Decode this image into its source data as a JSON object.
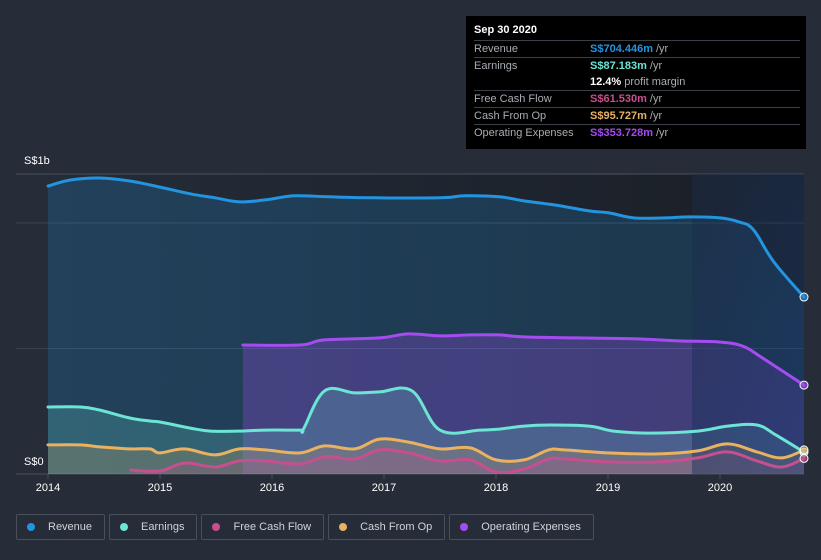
{
  "tooltip": {
    "date": "Sep 30 2020",
    "rows": [
      {
        "label": "Revenue",
        "value": "S$704.446m",
        "unit": "/yr",
        "color": "#2394df"
      },
      {
        "label": "Earnings",
        "value": "S$87.183m",
        "unit": "/yr",
        "color": "#6ce5d5"
      },
      {
        "label": "",
        "value": "12.4%",
        "unit": "profit margin",
        "color": "#ffffff"
      },
      {
        "label": "Free Cash Flow",
        "value": "S$61.530m",
        "unit": "/yr",
        "color": "#c84f8f"
      },
      {
        "label": "Cash From Op",
        "value": "S$95.727m",
        "unit": "/yr",
        "color": "#e9b160"
      },
      {
        "label": "Operating Expenses",
        "value": "S$353.728m",
        "unit": "/yr",
        "color": "#a54cf0"
      }
    ]
  },
  "legend": [
    {
      "label": "Revenue",
      "color": "#2394df"
    },
    {
      "label": "Earnings",
      "color": "#6ce5d5"
    },
    {
      "label": "Free Cash Flow",
      "color": "#c84f8f"
    },
    {
      "label": "Cash From Op",
      "color": "#e9b160"
    },
    {
      "label": "Operating Expenses",
      "color": "#a54cf0"
    }
  ],
  "chart_data": {
    "type": "area",
    "title": "",
    "xlabel": "",
    "ylabel": "",
    "y_tick_labels": [
      "S$0",
      "S$1b"
    ],
    "y_ticks": [
      0,
      1000
    ],
    "ylim": [
      0,
      1195
    ],
    "x_tick_labels": [
      "2014",
      "2015",
      "2016",
      "2017",
      "2018",
      "2019",
      "2020"
    ],
    "xlim": [
      2014.0,
      2020.75
    ],
    "grid": true,
    "legend_position": "bottom",
    "units": "S$ millions",
    "highlight_range": [
      2019.75,
      2020.75
    ],
    "series": [
      {
        "name": "Revenue",
        "color": "#2394df",
        "x": [
          2014.0,
          2014.2,
          2014.46,
          2014.73,
          2015.0,
          2015.27,
          2015.49,
          2015.71,
          2015.94,
          2016.2,
          2016.51,
          2016.91,
          2017.5,
          2017.72,
          2018.03,
          2018.25,
          2018.52,
          2018.83,
          2019.01,
          2019.23,
          2019.5,
          2019.73,
          2020.0,
          2020.17,
          2020.3,
          2020.48,
          2020.75
        ],
        "values": [
          1147,
          1171,
          1179,
          1167,
          1143,
          1116,
          1100,
          1084,
          1092,
          1108,
          1104,
          1100,
          1100,
          1108,
          1104,
          1088,
          1072,
          1048,
          1040,
          1020,
          1020,
          1024,
          1020,
          1004,
          972,
          845,
          705
        ]
      },
      {
        "name": "Earnings",
        "color": "#6ce5d5",
        "x": [
          2014.0,
          2014.29,
          2014.46,
          2014.73,
          2014.91,
          2015.0,
          2015.27,
          2015.45,
          2015.71,
          2015.94,
          2016.25,
          2016.28,
          2016.47,
          2016.74,
          2016.96,
          2017.25,
          2017.5,
          2017.86,
          2018.03,
          2018.25,
          2018.48,
          2018.83,
          2019.05,
          2019.36,
          2019.8,
          2020.07,
          2020.33,
          2020.5,
          2020.75
        ],
        "values": [
          267,
          267,
          255,
          223,
          211,
          207,
          183,
          171,
          171,
          175,
          175,
          179,
          331,
          323,
          327,
          331,
          175,
          175,
          179,
          191,
          195,
          191,
          171,
          163,
          171,
          191,
          195,
          155,
          87
        ]
      },
      {
        "name": "Free Cash Flow",
        "color": "#c84f8f",
        "x": [
          2014.74,
          2015.0,
          2015.22,
          2015.49,
          2015.71,
          2015.94,
          2016.25,
          2016.47,
          2016.74,
          2016.96,
          2017.22,
          2017.5,
          2017.77,
          2018.0,
          2018.25,
          2018.47,
          2018.61,
          2019.01,
          2019.45,
          2019.8,
          2020.07,
          2020.33,
          2020.55,
          2020.75
        ],
        "values": [
          16,
          12,
          44,
          28,
          52,
          52,
          40,
          68,
          60,
          96,
          84,
          52,
          56,
          8,
          20,
          60,
          60,
          48,
          48,
          64,
          88,
          52,
          28,
          62
        ]
      },
      {
        "name": "Cash From Op",
        "color": "#e9b160",
        "x": [
          2014.0,
          2014.29,
          2014.46,
          2014.73,
          2014.91,
          2015.0,
          2015.22,
          2015.49,
          2015.71,
          2015.94,
          2016.25,
          2016.47,
          2016.74,
          2016.96,
          2017.22,
          2017.5,
          2017.77,
          2018.0,
          2018.25,
          2018.47,
          2018.61,
          2019.01,
          2019.45,
          2019.8,
          2020.07,
          2020.33,
          2020.55,
          2020.75
        ],
        "values": [
          116,
          116,
          108,
          100,
          100,
          84,
          100,
          76,
          100,
          96,
          84,
          112,
          100,
          139,
          127,
          100,
          104,
          56,
          56,
          96,
          96,
          84,
          80,
          92,
          120,
          88,
          64,
          96
        ]
      },
      {
        "name": "Operating Expenses",
        "color": "#a54cf0",
        "x": [
          2015.74,
          2016.25,
          2016.47,
          2016.96,
          2017.22,
          2017.5,
          2017.77,
          2018.03,
          2018.25,
          2018.74,
          2019.27,
          2019.63,
          2019.98,
          2020.2,
          2020.38,
          2020.75
        ],
        "values": [
          514,
          514,
          534,
          542,
          558,
          550,
          554,
          554,
          546,
          542,
          538,
          530,
          526,
          510,
          462,
          354
        ]
      }
    ]
  }
}
